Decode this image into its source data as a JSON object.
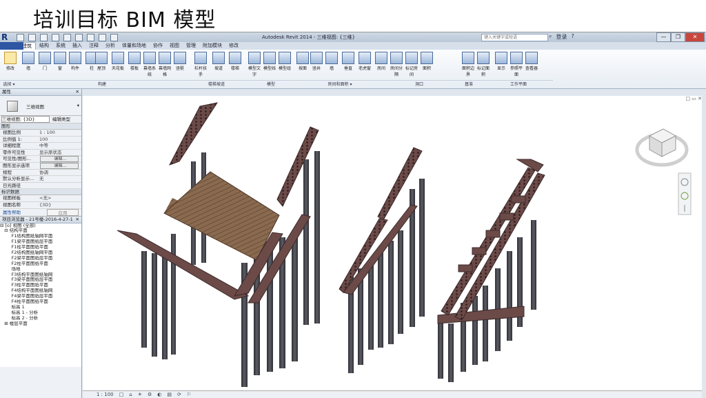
{
  "slide_title": "培训目标 BIM 模型",
  "app": {
    "title": "Autodesk Revit 2014 -   三维视图: {三维}",
    "search_placeholder": "键入关键字或短语",
    "signin": "登录",
    "help": "?",
    "window_buttons": [
      "—",
      "❐",
      "✕"
    ]
  },
  "tabs": [
    "建筑",
    "结构",
    "系统",
    "插入",
    "注释",
    "分析",
    "体量和场地",
    "协作",
    "视图",
    "管理",
    "附加模块",
    "修改"
  ],
  "ribbon": {
    "tools": [
      {
        "label": "修改",
        "selected": true
      },
      {
        "label": "墙"
      },
      {
        "label": "门"
      },
      {
        "label": "窗"
      },
      {
        "label": "构件"
      },
      {
        "label": "柱"
      },
      {
        "label": "屋顶"
      },
      {
        "label": "天花板"
      },
      {
        "label": "楼板"
      },
      {
        "label": "幕墙系统"
      },
      {
        "label": "幕墙网格"
      },
      {
        "label": "竖梃"
      },
      {
        "label": "栏杆扶手"
      },
      {
        "label": "坡道"
      },
      {
        "label": "楼梯"
      },
      {
        "label": "模型文字"
      },
      {
        "label": "模型线"
      },
      {
        "label": "模型组"
      },
      {
        "label": "按面"
      },
      {
        "label": "竖井"
      },
      {
        "label": "墙"
      },
      {
        "label": "垂直"
      },
      {
        "label": "老虎窗"
      },
      {
        "label": "房间"
      },
      {
        "label": "房间分隔"
      },
      {
        "label": "标记房间"
      },
      {
        "label": "面积"
      },
      {
        "label": "面积边界"
      },
      {
        "label": "标记面积"
      },
      {
        "label": "显示"
      },
      {
        "label": "参照平面"
      },
      {
        "label": "查看器"
      }
    ],
    "panels": [
      "选择 ▾",
      "构建",
      "楼梯坡道",
      "模型",
      "房间和面积 ▾",
      "洞口",
      "基准",
      "工作平面"
    ]
  },
  "properties": {
    "header": "属性",
    "type_name": "三维视图",
    "view_dropdown": "三维视图: {3D}",
    "edit_type": "编辑类型",
    "section_graphics": "图形",
    "rows": [
      {
        "k": "视图比例",
        "v": "1 : 100"
      },
      {
        "k": "比例值 1:",
        "v": "100"
      },
      {
        "k": "详细程度",
        "v": "中等"
      },
      {
        "k": "零件可见性",
        "v": "显示原状态"
      },
      {
        "k": "可见性/图形...",
        "v": "编辑..."
      },
      {
        "k": "图形显示选项",
        "v": "编辑..."
      },
      {
        "k": "规程",
        "v": "协调"
      },
      {
        "k": "默认分析显示...",
        "v": "无"
      },
      {
        "k": "日光路径",
        "v": ""
      }
    ],
    "section_extents": "标识数据",
    "rows2": [
      {
        "k": "视图样板",
        "v": "<无>"
      },
      {
        "k": "视图名称",
        "v": "{3D}"
      }
    ],
    "help_link": "属性帮助",
    "apply": "应用"
  },
  "browser": {
    "header": "项目浏览器 - 21号楼-2016-4-27-1",
    "items": [
      "⊟ [o] 视图 (全部)",
      "   ⊟ 结构平面",
      "        F1结构图纸轴网平面",
      "        F1梁平面图纸层平面",
      "        F1柱平面图纸平面",
      "        F2结构图纸轴网平面",
      "        F2梁平面图纸层平面",
      "        F2柱平面图纸平面",
      "        场地",
      "        F3结构平面图纸轴网",
      "        F3梁平面图纸层平面",
      "        F3柱平面图纸平面",
      "        F4结构平面图纸轴网",
      "        F4梁平面图纸层平面",
      "        F4柱平面图纸平面",
      "        标高 1",
      "        标高 1 - 分析",
      "        标高 2 - 分析",
      "   ⊞ 楼层平面"
    ]
  },
  "canvas": {
    "view_controls": "□ ▭ ✕",
    "viewcube_label": "上",
    "nav_bar_items": [
      "⊙",
      "◎",
      "⇕"
    ],
    "status": [
      "1 : 100",
      "□",
      "⌂",
      "☀",
      "⚙",
      "◐",
      "▤",
      "⟳",
      "⚐"
    ]
  },
  "colors": {
    "beam": "#6b4a48",
    "beam_dark": "#3c2a2a",
    "deck": "#8a6a4f",
    "deck_line": "#4b3526",
    "column": "#4a4a52"
  }
}
